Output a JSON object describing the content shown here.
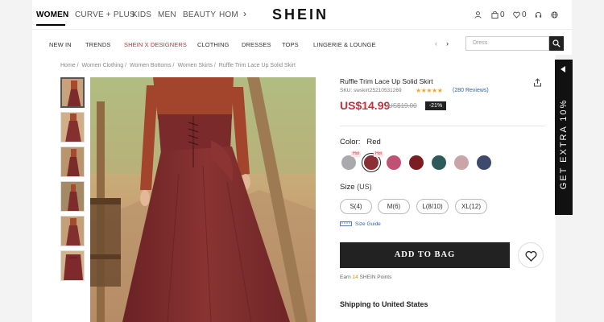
{
  "topbar": {
    "categories": [
      "WOMEN",
      "CURVE + PLUS",
      "KIDS",
      "MEN",
      "BEAUTY",
      "HOM"
    ],
    "logo": "SHEIN",
    "bag_count": "0",
    "wishlist_count": "0"
  },
  "subnav": {
    "items": [
      "NEW IN",
      "TRENDS",
      "SHEIN X DESIGNERS",
      "CLOTHING",
      "DRESSES",
      "TOPS",
      "LINGERIE & LOUNGE"
    ],
    "search_placeholder": "Dress"
  },
  "breadcrumb": [
    "Home /",
    "Women Clothing /",
    "Women Bottoms /",
    "Women Skirts /",
    "Ruffle Trim Lace Up Solid Skirt"
  ],
  "product": {
    "title": "Ruffle Trim Lace Up Solid Skirt",
    "sku": "SKU: swskirt25210531269",
    "rating_stars": "★★★★★",
    "reviews": "(280 Reviews)",
    "price": "US$14.99",
    "old_price": "US$19.00",
    "discount": "-21%",
    "color_label": "Color:",
    "color_value": "Red",
    "hot_badge": "Hot",
    "swatches": [
      "#a9aaae",
      "#8a2f35",
      "#c05074",
      "#7b1e22",
      "#2f5a5a",
      "#c9a5aa",
      "#3d4a6e"
    ],
    "size_label": "Size",
    "size_unit": "(US)",
    "sizes": [
      "S(4)",
      "M(6)",
      "L(8/10)",
      "XL(12)"
    ],
    "size_guide": "Size Guide",
    "add_to_bag": "ADD TO BAG",
    "points_prefix": "Earn",
    "points_value": "14",
    "points_suffix": "SHEIN Points",
    "shipping": "Shipping to United States"
  },
  "side_tab": "GET EXTRA 10%",
  "colors": {
    "accent": "#c4303c",
    "link": "#2f5fb3",
    "dark": "#222222"
  }
}
